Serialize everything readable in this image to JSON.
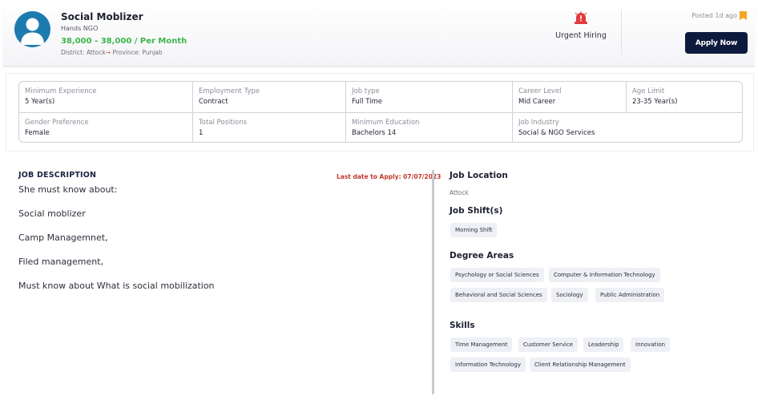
{
  "job": {
    "title": "Social Moblizer",
    "company": "Hands NGO",
    "salary": "38,000 - 38,000 / Per Month",
    "district_label": "District: Attock",
    "arrow": "→",
    "province_label": " Province: Punjab",
    "urgent": "Urgent Hiring",
    "posted": "Posted 1d ago",
    "apply_label": "Apply Now"
  },
  "info": {
    "cells": [
      {
        "label": "Minimum Experience",
        "value": "5 Year(s)"
      },
      {
        "label": "Employment Type",
        "value": "Contract"
      },
      {
        "label": "Job type",
        "value": "Full Time"
      },
      {
        "label": "Career Level",
        "value": "Mid Career"
      },
      {
        "label": "Age Limit",
        "value": "23-35 Year(s)"
      },
      {
        "label": "Gender Preference",
        "value": "Female"
      },
      {
        "label": "Total Positions",
        "value": "1"
      },
      {
        "label": "Minimum Education",
        "value": "Bachelors 14"
      },
      {
        "label": "Job Industry",
        "value": "Social & NGO Services"
      }
    ]
  },
  "description": {
    "heading": "JOB DESCRIPTION",
    "last_date": "Last date to Apply: 07/07/2023",
    "lines": [
      "She must know about:",
      "Social moblizer",
      "Camp Managemnet,",
      "Filed management,",
      "Must know about What is social mobilization"
    ]
  },
  "sidebar": {
    "location_heading": "Job Location",
    "location": "Attock",
    "shift_heading": "Job Shift(s)",
    "shifts": [
      "Morning Shift"
    ],
    "degree_heading": "Degree Areas",
    "degrees": [
      "Psychology or Social Sciences",
      "Computer & Information Technology",
      "Behavioral and Social Sciences",
      "Sociology",
      "Public Administration"
    ],
    "skills_heading": "Skills",
    "skills": [
      "Time Management",
      "Customer Service",
      "Leadership",
      "Innovation",
      "Information Technology",
      "Client Relationship Management"
    ]
  },
  "colors": {
    "salary": "#3bb54a",
    "apply_button": "#0e1a3d",
    "urgent_icon": "#e23a3a",
    "bookmark": "#f5a623",
    "last_date": "#c0392b",
    "avatar_bg": "#1e7bb0"
  },
  "icons": {
    "avatar": "user-avatar-icon",
    "urgent": "siren-icon",
    "posted": "bookmark-icon"
  }
}
